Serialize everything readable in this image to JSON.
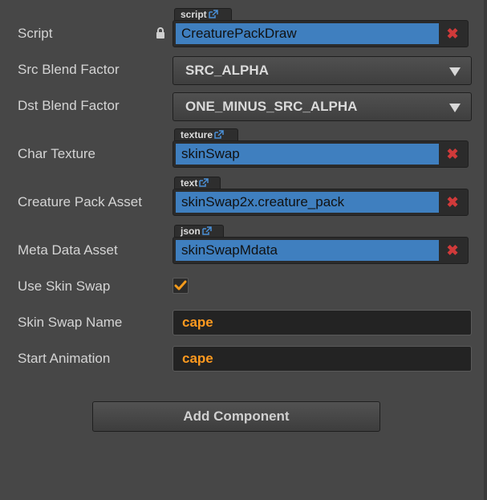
{
  "properties": {
    "script": {
      "label": "Script",
      "asset_type": "script",
      "value": "CreaturePackDraw",
      "clear": "✖"
    },
    "src_blend": {
      "label": "Src Blend Factor",
      "value": "SRC_ALPHA"
    },
    "dst_blend": {
      "label": "Dst Blend Factor",
      "value": "ONE_MINUS_SRC_ALPHA"
    },
    "char_texture": {
      "label": "Char Texture",
      "asset_type": "texture",
      "value": "skinSwap",
      "clear": "✖"
    },
    "creature_pack_asset": {
      "label": "Creature Pack Asset",
      "asset_type": "text",
      "value": "skinSwap2x.creature_pack",
      "clear": "✖"
    },
    "meta_data_asset": {
      "label": "Meta Data Asset",
      "asset_type": "json",
      "value": "skinSwapMdata",
      "clear": "✖"
    },
    "use_skin_swap": {
      "label": "Use Skin Swap",
      "checked": true
    },
    "skin_swap_name": {
      "label": "Skin Swap Name",
      "value": "cape"
    },
    "start_animation": {
      "label": "Start Animation",
      "value": "cape"
    }
  },
  "add_component_label": "Add Component",
  "colors": {
    "panel_bg": "#474747",
    "asset_blue": "#3f7fbf",
    "clear_red": "#d03a3a",
    "text_orange": "#ff9a1f",
    "check_orange": "#f39a1c"
  }
}
